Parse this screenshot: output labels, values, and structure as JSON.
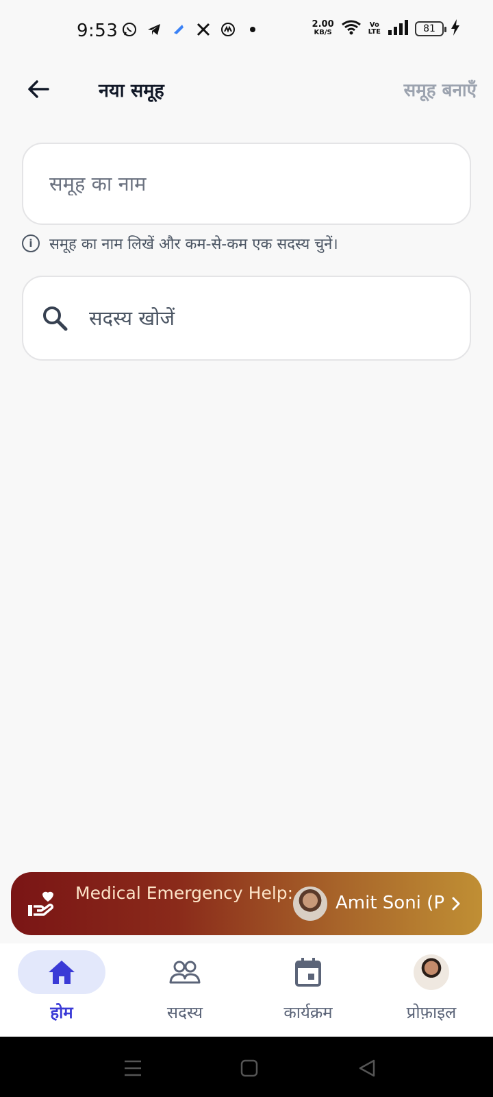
{
  "status_bar": {
    "time": "9:53",
    "net_speed_value": "2.00",
    "net_speed_unit": "KB/S",
    "volte_top": "Vo",
    "volte_bottom": "LTE",
    "battery": "81"
  },
  "header": {
    "title": "नया समूह",
    "create_label": "समूह बनाएँ"
  },
  "form": {
    "name_placeholder": "समूह का नाम",
    "name_value": "",
    "hint": "समूह का नाम लिखें और कम-से-कम एक सदस्य चुनें।",
    "search_placeholder": "सदस्य खोजें",
    "search_value": ""
  },
  "emergency_banner": {
    "marquee_text": "Medical Emergency Help:",
    "contact_name": "Amit Soni (P",
    "colors": {
      "start": "#7a1515",
      "end": "#c08f34"
    }
  },
  "bottom_nav": {
    "items": [
      {
        "label": "होम",
        "icon": "home-icon",
        "active": true
      },
      {
        "label": "सदस्य",
        "icon": "members-icon",
        "active": false
      },
      {
        "label": "कार्यक्रम",
        "icon": "calendar-icon",
        "active": false
      },
      {
        "label": "प्रोफ़ाइल",
        "icon": "profile-avatar",
        "active": false
      }
    ],
    "active_color": "#3a3ad6"
  }
}
